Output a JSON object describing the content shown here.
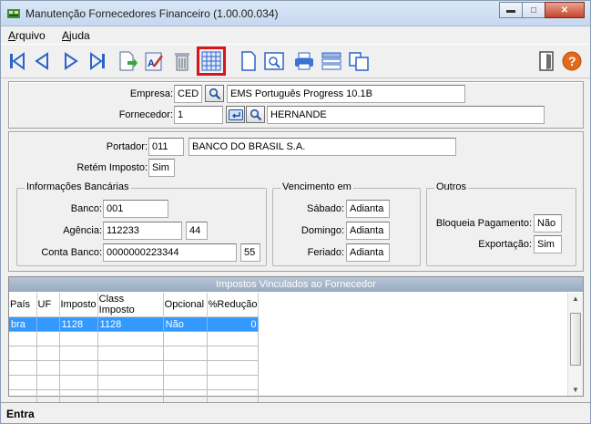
{
  "window": {
    "title": "Manutenção Fornecedores Financeiro (1.00.00.034)"
  },
  "menu": [
    {
      "label": "Arquivo"
    },
    {
      "label": "Ajuda"
    }
  ],
  "toolbar": [
    "first-icon",
    "prev-icon",
    "next-icon",
    "last-icon",
    "new-icon",
    "edit-icon",
    "delete-icon",
    "calendar-grid-icon",
    "blank-page-icon",
    "zoom-icon",
    "print-icon",
    "list-settings-icon",
    "copy-icon",
    "exit-icon",
    "help-icon"
  ],
  "header": {
    "empresa_label": "Empresa:",
    "empresa_value": "CED",
    "empresa_desc": "EMS Português Progress 10.1B",
    "fornecedor_label": "Fornecedor:",
    "fornecedor_value": "1",
    "fornecedor_desc": "HERNANDE"
  },
  "details": {
    "portador_label": "Portador:",
    "portador_code": "011",
    "portador_desc": "BANCO DO BRASIL S.A.",
    "retem_label": "Retém Imposto:",
    "retem_value": "Sim"
  },
  "banco": {
    "title": "Informações Bancárias",
    "banco_label": "Banco:",
    "banco_value": "001",
    "agencia_label": "Agência:",
    "agencia_value": "112233",
    "agencia_dv": "44",
    "conta_label": "Conta Banco:",
    "conta_value": "0000000223344",
    "conta_dv": "55"
  },
  "vencimento": {
    "title": "Vencimento em",
    "sabado_label": "Sábado:",
    "sabado_value": "Adianta",
    "domingo_label": "Domingo:",
    "domingo_value": "Adianta",
    "feriado_label": "Feriado:",
    "feriado_value": "Adianta"
  },
  "outros": {
    "title": "Outros",
    "bloqueia_label": "Bloqueia Pagamento:",
    "bloqueia_value": "Não",
    "exportacao_label": "Exportação:",
    "exportacao_value": "Sim"
  },
  "grid": {
    "title": "Impostos Vinculados ao Fornecedor",
    "columns": [
      "País",
      "UF",
      "Imposto",
      "Class Imposto",
      "Opcional",
      "%Redução"
    ],
    "rows": [
      [
        "bra",
        "",
        "1128",
        "1128",
        "Não",
        "0"
      ]
    ]
  },
  "status": {
    "text": "Entra"
  },
  "colors": {
    "highlight": "#d9141a",
    "selection": "#3399ff",
    "grid_header": "#98aac2"
  }
}
